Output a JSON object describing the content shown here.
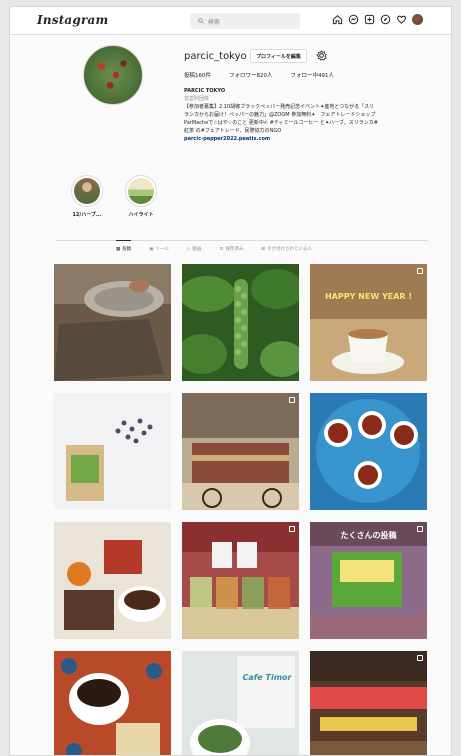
{
  "header": {
    "logo": "Instagram",
    "search_placeholder": "検索"
  },
  "profile": {
    "username": "parcic_tokyo",
    "edit_button": "プロフィールを編集",
    "stats": {
      "posts": "投稿160件",
      "followers": "フォロワー820人",
      "following": "フォロー中491人"
    },
    "bio": {
      "name": "PARCIC TOKYO",
      "category": "非営利団体",
      "line1": "【参加者募集】2.10胡椒ブラックペッパー発売記念イベント✦産地とつながる「スリ",
      "line2": "ランカからお届け！ペッパーの魅力」@ZOOM 参加無料✦　フェアトレードショップ",
      "line3": "ParMacheで☆はや☆のこと 更新中✍ #ティミールコーヒー と✦ハーブ、スリランカ#",
      "line4": "紅茶 の#フェアトレード、民際協力のNGO",
      "link": "parcic-pepper2022.peatix.com"
    }
  },
  "highlights": [
    {
      "label": "12/ハーブ..."
    },
    {
      "label": "ハイライト"
    }
  ],
  "tabs": [
    {
      "label": "投稿",
      "active": true
    },
    {
      "label": "リール",
      "active": false
    },
    {
      "label": "動画",
      "active": false
    },
    {
      "label": "保存済み",
      "active": false
    },
    {
      "label": "タグ付けされている人",
      "active": false
    }
  ],
  "posts": [
    {
      "overlay_text": ""
    },
    {
      "overlay_text": ""
    },
    {
      "overlay_text": "HAPPY NEW YEAR !"
    },
    {
      "overlay_text": ""
    },
    {
      "overlay_text": ""
    },
    {
      "overlay_text": ""
    },
    {
      "overlay_text": ""
    },
    {
      "overlay_text": ""
    },
    {
      "overlay_text": "たくさんの投稿"
    },
    {
      "overlay_text": ""
    },
    {
      "overlay_text": "Cafe Timor"
    },
    {
      "overlay_text": ""
    }
  ],
  "colors": {
    "accent": "#0095f6",
    "text": "#262626",
    "muted": "#8e8e8e",
    "link": "#00376b"
  }
}
